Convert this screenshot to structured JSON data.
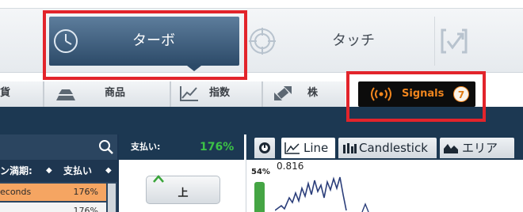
{
  "modes": {
    "turbo_label": "ターボ",
    "touch_label": "タッチ"
  },
  "asset_tabs": {
    "currency": "貨",
    "commodities": "商品",
    "indices": "指数",
    "stocks": "株"
  },
  "signals": {
    "label": "Signals",
    "count": "7"
  },
  "expiry_table": {
    "headers": [
      "ン満期:",
      "支払い"
    ],
    "sort_icon": "◆",
    "rows": [
      {
        "expiry": "econds",
        "payout": "176%"
      },
      {
        "expiry": "",
        "payout": "176%"
      }
    ]
  },
  "payout": {
    "label": "支払い:",
    "value": "176%"
  },
  "up_button": {
    "label": "上"
  },
  "chart": {
    "tools": {
      "line": "Line",
      "candlestick": "Candlestick",
      "area": "エリア"
    },
    "percent_label": "54%",
    "price_label": "0.816",
    "colors": {
      "line": "#2b3e7a",
      "gauge": "#45a544"
    }
  },
  "colors": {
    "turbo_active": "#2c4a68",
    "signals_text": "#f0851e",
    "payout_value": "#3cc246",
    "highlight": "#e2242b",
    "dark_band": "#1c3852"
  }
}
